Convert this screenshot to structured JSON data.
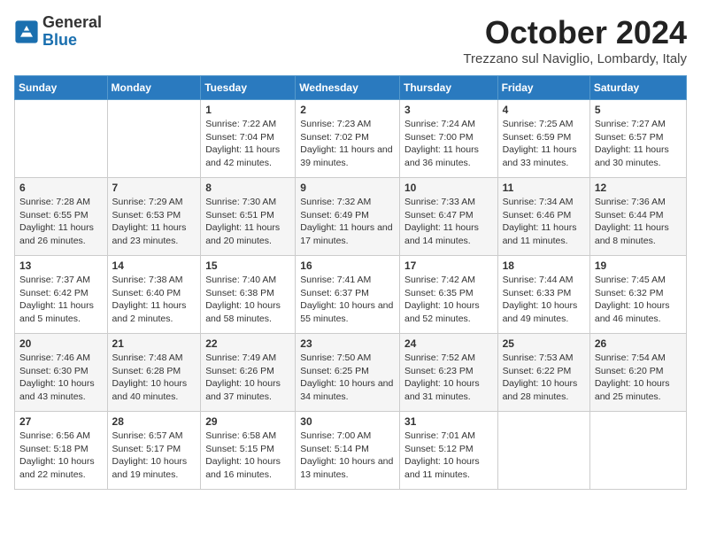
{
  "logo": {
    "general": "General",
    "blue": "Blue"
  },
  "header": {
    "month": "October 2024",
    "location": "Trezzano sul Naviglio, Lombardy, Italy"
  },
  "weekdays": [
    "Sunday",
    "Monday",
    "Tuesday",
    "Wednesday",
    "Thursday",
    "Friday",
    "Saturday"
  ],
  "weeks": [
    [
      {
        "day": "",
        "info": ""
      },
      {
        "day": "",
        "info": ""
      },
      {
        "day": "1",
        "info": "Sunrise: 7:22 AM\nSunset: 7:04 PM\nDaylight: 11 hours and 42 minutes."
      },
      {
        "day": "2",
        "info": "Sunrise: 7:23 AM\nSunset: 7:02 PM\nDaylight: 11 hours and 39 minutes."
      },
      {
        "day": "3",
        "info": "Sunrise: 7:24 AM\nSunset: 7:00 PM\nDaylight: 11 hours and 36 minutes."
      },
      {
        "day": "4",
        "info": "Sunrise: 7:25 AM\nSunset: 6:59 PM\nDaylight: 11 hours and 33 minutes."
      },
      {
        "day": "5",
        "info": "Sunrise: 7:27 AM\nSunset: 6:57 PM\nDaylight: 11 hours and 30 minutes."
      }
    ],
    [
      {
        "day": "6",
        "info": "Sunrise: 7:28 AM\nSunset: 6:55 PM\nDaylight: 11 hours and 26 minutes."
      },
      {
        "day": "7",
        "info": "Sunrise: 7:29 AM\nSunset: 6:53 PM\nDaylight: 11 hours and 23 minutes."
      },
      {
        "day": "8",
        "info": "Sunrise: 7:30 AM\nSunset: 6:51 PM\nDaylight: 11 hours and 20 minutes."
      },
      {
        "day": "9",
        "info": "Sunrise: 7:32 AM\nSunset: 6:49 PM\nDaylight: 11 hours and 17 minutes."
      },
      {
        "day": "10",
        "info": "Sunrise: 7:33 AM\nSunset: 6:47 PM\nDaylight: 11 hours and 14 minutes."
      },
      {
        "day": "11",
        "info": "Sunrise: 7:34 AM\nSunset: 6:46 PM\nDaylight: 11 hours and 11 minutes."
      },
      {
        "day": "12",
        "info": "Sunrise: 7:36 AM\nSunset: 6:44 PM\nDaylight: 11 hours and 8 minutes."
      }
    ],
    [
      {
        "day": "13",
        "info": "Sunrise: 7:37 AM\nSunset: 6:42 PM\nDaylight: 11 hours and 5 minutes."
      },
      {
        "day": "14",
        "info": "Sunrise: 7:38 AM\nSunset: 6:40 PM\nDaylight: 11 hours and 2 minutes."
      },
      {
        "day": "15",
        "info": "Sunrise: 7:40 AM\nSunset: 6:38 PM\nDaylight: 10 hours and 58 minutes."
      },
      {
        "day": "16",
        "info": "Sunrise: 7:41 AM\nSunset: 6:37 PM\nDaylight: 10 hours and 55 minutes."
      },
      {
        "day": "17",
        "info": "Sunrise: 7:42 AM\nSunset: 6:35 PM\nDaylight: 10 hours and 52 minutes."
      },
      {
        "day": "18",
        "info": "Sunrise: 7:44 AM\nSunset: 6:33 PM\nDaylight: 10 hours and 49 minutes."
      },
      {
        "day": "19",
        "info": "Sunrise: 7:45 AM\nSunset: 6:32 PM\nDaylight: 10 hours and 46 minutes."
      }
    ],
    [
      {
        "day": "20",
        "info": "Sunrise: 7:46 AM\nSunset: 6:30 PM\nDaylight: 10 hours and 43 minutes."
      },
      {
        "day": "21",
        "info": "Sunrise: 7:48 AM\nSunset: 6:28 PM\nDaylight: 10 hours and 40 minutes."
      },
      {
        "day": "22",
        "info": "Sunrise: 7:49 AM\nSunset: 6:26 PM\nDaylight: 10 hours and 37 minutes."
      },
      {
        "day": "23",
        "info": "Sunrise: 7:50 AM\nSunset: 6:25 PM\nDaylight: 10 hours and 34 minutes."
      },
      {
        "day": "24",
        "info": "Sunrise: 7:52 AM\nSunset: 6:23 PM\nDaylight: 10 hours and 31 minutes."
      },
      {
        "day": "25",
        "info": "Sunrise: 7:53 AM\nSunset: 6:22 PM\nDaylight: 10 hours and 28 minutes."
      },
      {
        "day": "26",
        "info": "Sunrise: 7:54 AM\nSunset: 6:20 PM\nDaylight: 10 hours and 25 minutes."
      }
    ],
    [
      {
        "day": "27",
        "info": "Sunrise: 6:56 AM\nSunset: 5:18 PM\nDaylight: 10 hours and 22 minutes."
      },
      {
        "day": "28",
        "info": "Sunrise: 6:57 AM\nSunset: 5:17 PM\nDaylight: 10 hours and 19 minutes."
      },
      {
        "day": "29",
        "info": "Sunrise: 6:58 AM\nSunset: 5:15 PM\nDaylight: 10 hours and 16 minutes."
      },
      {
        "day": "30",
        "info": "Sunrise: 7:00 AM\nSunset: 5:14 PM\nDaylight: 10 hours and 13 minutes."
      },
      {
        "day": "31",
        "info": "Sunrise: 7:01 AM\nSunset: 5:12 PM\nDaylight: 10 hours and 11 minutes."
      },
      {
        "day": "",
        "info": ""
      },
      {
        "day": "",
        "info": ""
      }
    ]
  ]
}
